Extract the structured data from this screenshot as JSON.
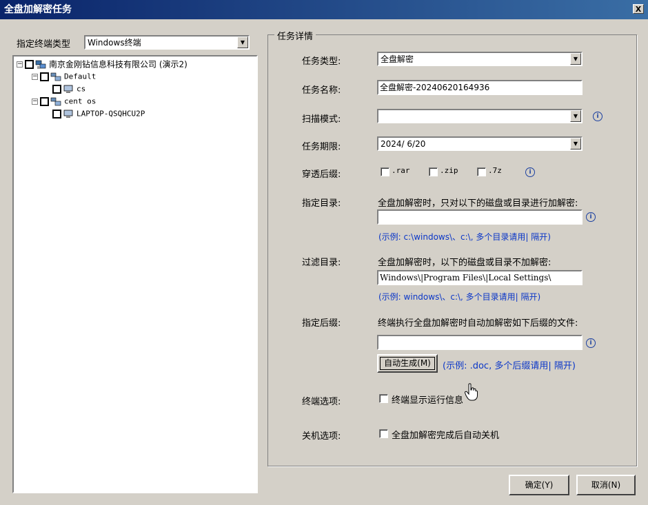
{
  "window": {
    "title": "全盘加解密任务",
    "close_label": "X"
  },
  "left": {
    "terminal_type_label": "指定终端类型",
    "terminal_type_value": "Windows终端",
    "tree": {
      "root": "南京金刚钻信息科技有限公司 (演示2)",
      "groups": [
        {
          "name": "Default",
          "children": [
            "cs"
          ]
        },
        {
          "name": "cent os",
          "children": [
            "LAPTOP-QSQHCU2P"
          ]
        }
      ]
    }
  },
  "details": {
    "group_title": "任务详情",
    "task_type": {
      "label": "任务类型:",
      "value": "全盘解密"
    },
    "task_name": {
      "label": "任务名称:",
      "value": "全盘解密-20240620164936"
    },
    "scan_mode": {
      "label": "扫描模式:",
      "value": ""
    },
    "deadline": {
      "label": "任务期限:",
      "value": "2024/ 6/20"
    },
    "archive": {
      "label": "穿透后缀:",
      "options": [
        ".rar",
        ".zip",
        ".7z"
      ]
    },
    "target_dir": {
      "label": "指定目录:",
      "description": "全盘加解密时，只对以下的磁盘或目录进行加解密:",
      "value": "",
      "hint": "(示例: c:\\windows\\、c:\\, 多个目录请用| 隔开)"
    },
    "filter_dir": {
      "label": "过滤目录:",
      "description": "全盘加解密时，以下的磁盘或目录不加解密:",
      "value": "Windows\\|Program Files\\|Local Settings\\",
      "hint": "(示例: windows\\、c:\\, 多个目录请用| 隔开)"
    },
    "suffix": {
      "label": "指定后缀:",
      "description": "终端执行全盘加解密时自动加解密如下后缀的文件:",
      "value": "",
      "auto_button": "自动生成(M)",
      "hint": "(示例: .doc, 多个后缀请用| 隔开)"
    },
    "terminal_option": {
      "label": "终端选项:",
      "checkbox": "终端显示运行信息"
    },
    "shutdown_option": {
      "label": "关机选项:",
      "checkbox": "全盘加解密完成后自动关机"
    }
  },
  "footer": {
    "ok": "确定(Y)",
    "cancel": "取消(N)"
  },
  "colors": {
    "titlebar": "#0a246a",
    "hint_text": "#0a36c8",
    "dialog_bg": "#d4d0c8"
  }
}
